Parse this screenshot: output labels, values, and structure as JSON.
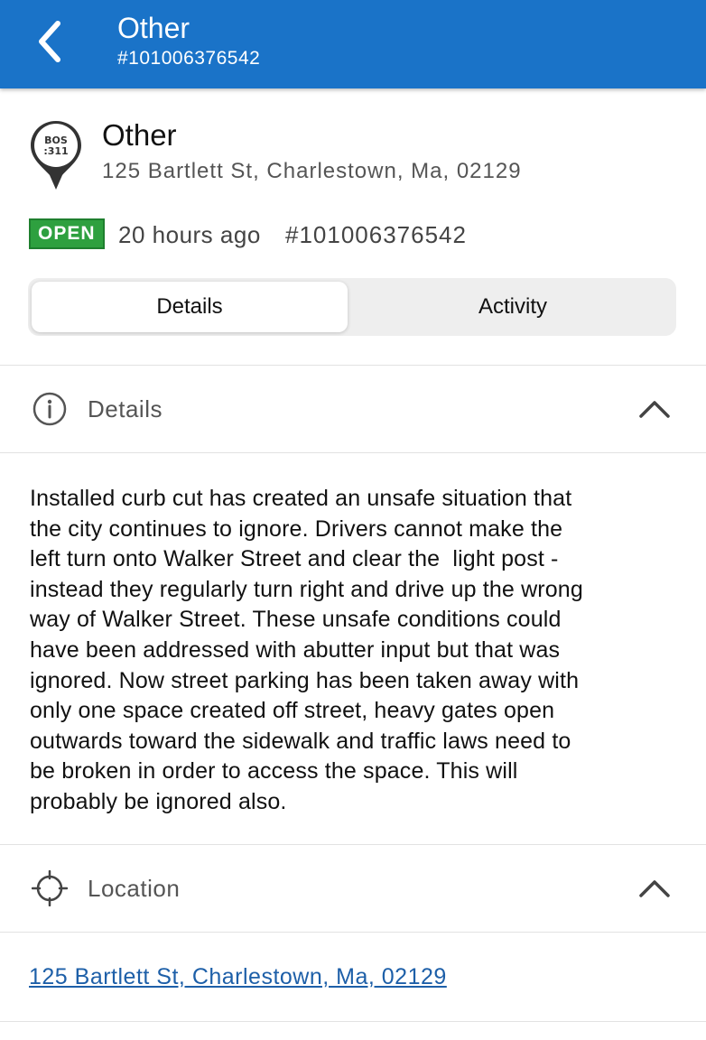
{
  "header": {
    "title": "Other",
    "subtitle": "#101006376542",
    "back_icon": "chevron-left-icon",
    "background": "#1a73c8"
  },
  "request": {
    "title": "Other",
    "address": "125 Bartlett St, Charlestown, Ma, 02129",
    "pin_icon": "bos-311-pin-icon",
    "pin_line1": "BOS",
    "pin_line2": ":311",
    "status": "OPEN",
    "status_color": "#2ea03f",
    "time_ago": "20 hours ago",
    "case_id": "#101006376542"
  },
  "tabs": [
    {
      "label": "Details",
      "selected": true
    },
    {
      "label": "Activity",
      "selected": false
    }
  ],
  "details_section": {
    "icon": "info-icon",
    "label": "Details",
    "expanded": true,
    "body": [
      "Installed curb cut has created an unsafe situation that",
      "the city continues to ignore. Drivers cannot make the",
      "left turn onto Walker Street and clear the  light post -",
      "instead they regularly turn right and drive up the wrong",
      "way of Walker Street. These unsafe conditions could",
      "have been addressed with abutter input but that was",
      "ignored. Now street parking has been taken away with",
      "only one space created off street, heavy gates open",
      "outwards toward the sidewalk and traffic laws need to",
      "be broken in order to access the space. This will",
      "probably be ignored also."
    ]
  },
  "location_section": {
    "icon": "crosshair-icon",
    "label": "Location",
    "expanded": true,
    "link_text": "125 Bartlett St, Charlestown, Ma, 02129",
    "link_color": "#1d5fa8"
  }
}
